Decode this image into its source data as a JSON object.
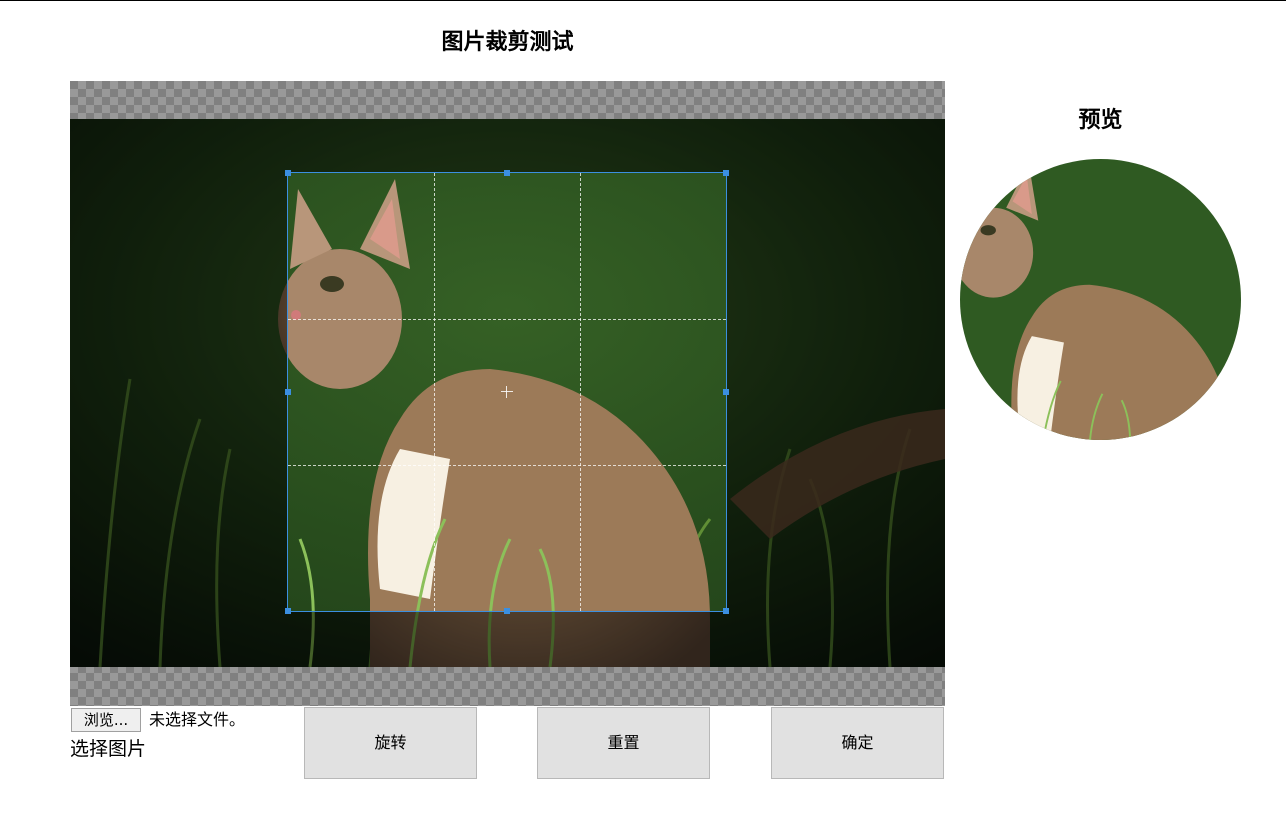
{
  "page": {
    "title": "图片裁剪测试"
  },
  "cropper": {
    "image_subject": "kitten sitting in grass",
    "crop_handle_color": "#3b8fe0"
  },
  "preview": {
    "title": "预览"
  },
  "file_input": {
    "button_label": "浏览...",
    "status_text": "未选择文件。",
    "label": "选择图片"
  },
  "actions": {
    "rotate_label": "旋转",
    "reset_label": "重置",
    "confirm_label": "确定"
  }
}
